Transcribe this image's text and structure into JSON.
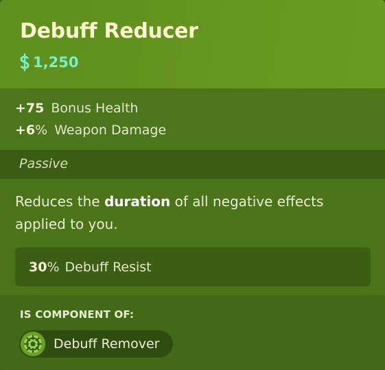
{
  "item": {
    "title": "Debuff Reducer",
    "price": "1,250",
    "currency_icon": "dollar-icon"
  },
  "stats": [
    {
      "value": "75",
      "prefix": "+",
      "suffix": "",
      "label": "Bonus Health"
    },
    {
      "value": "6",
      "prefix": "+",
      "suffix": "%",
      "label": "Weapon Damage"
    }
  ],
  "passive": {
    "label": "Passive",
    "description_before": "Reduces the ",
    "description_highlight": "duration",
    "description_after": " of all negative effects applied to you.",
    "resist_value": "30",
    "resist_suffix": "%",
    "resist_label": "Debuff Resist"
  },
  "components": {
    "heading": "IS COMPONENT OF:",
    "items": [
      {
        "name": "Debuff Remover",
        "icon": "debuff-remover-icon"
      }
    ]
  },
  "colors": {
    "title": "#fbf6cf",
    "price": "#76f0c8",
    "header_bg": "#6a9c22",
    "passive_bar": "#3b5c13"
  }
}
